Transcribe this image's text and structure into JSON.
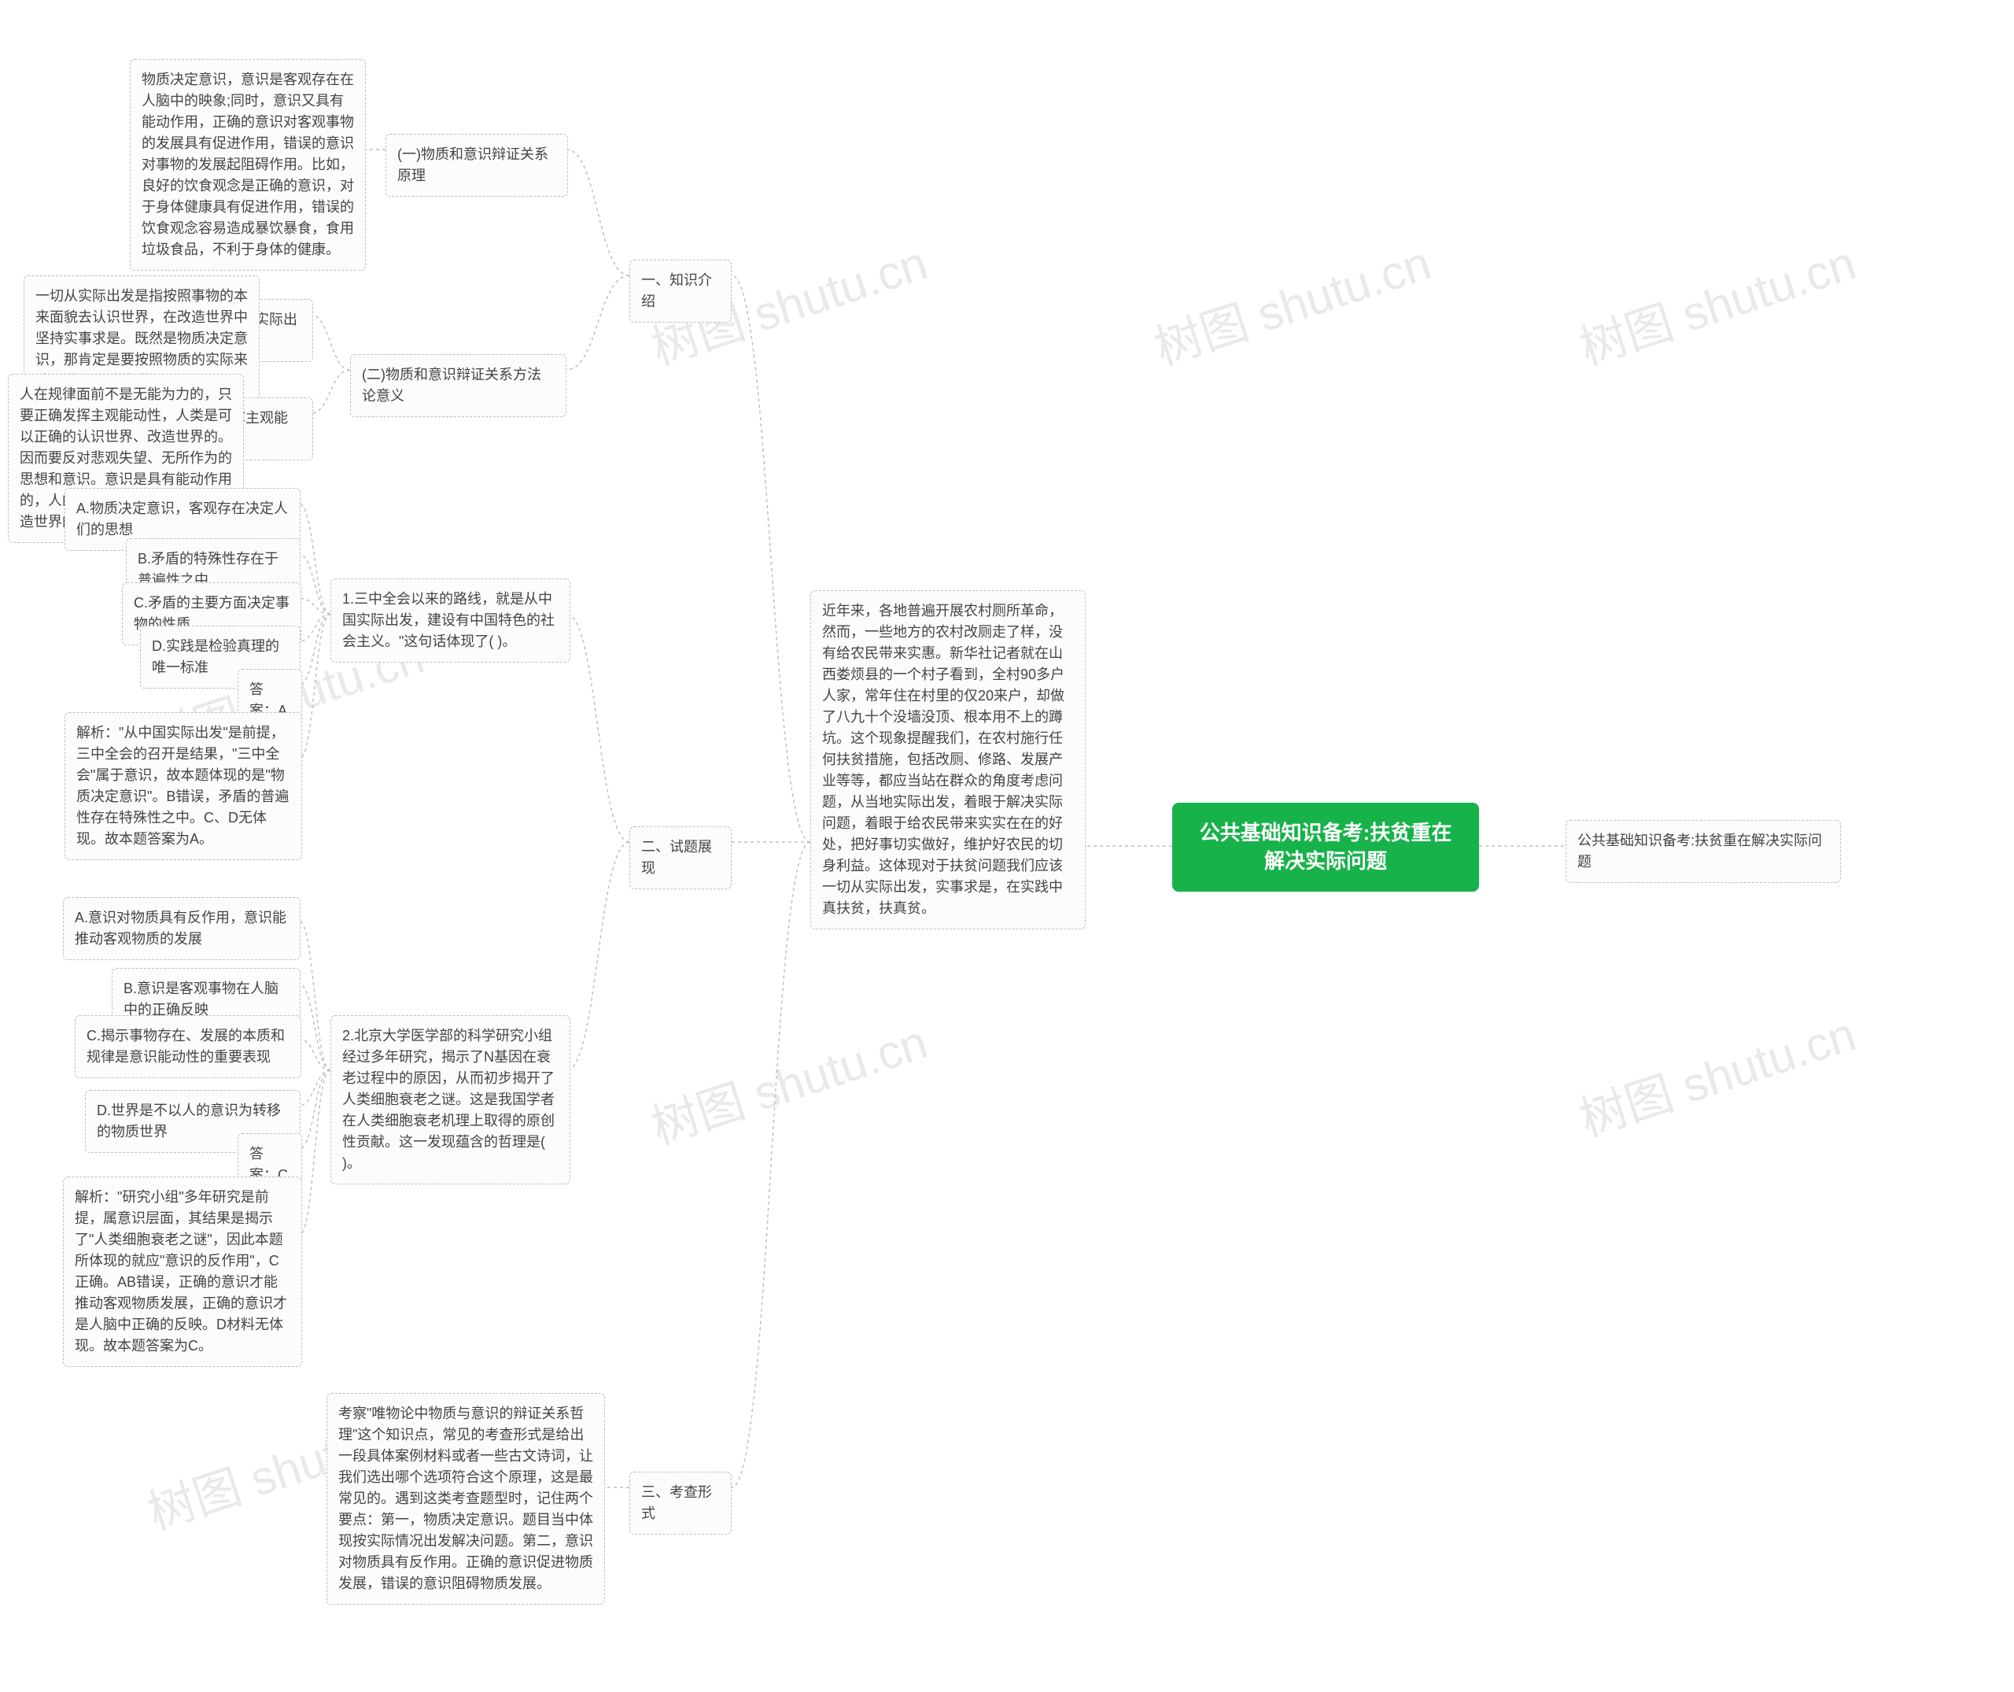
{
  "root": {
    "title": "公共基础知识备考:扶贫重在解决实际问题"
  },
  "right_leaf": {
    "text": "公共基础知识备考:扶贫重在解决实际问题"
  },
  "intro_paragraph": "近年来，各地普遍开展农村厕所革命，然而，一些地方的农村改厕走了样，没有给农民带来实惠。新华社记者就在山西娄烦县的一个村子看到，全村90多户人家，常年住在村里的仅20来户，却做了八九十个没墙没顶、根本用不上的蹲坑。这个现象提醒我们，在农村施行任何扶贫措施，包括改厕、修路、发展产业等等，都应当站在群众的角度考虑问题，从当地实际出发，着眼于解决实际问题，着眼于给农民带来实实在在的好处，把好事切实做好，维护好农民的切身利益。这体现对于扶贫问题我们应该一切从实际出发，实事求是，在实践中真扶贫，扶真贫。",
  "section1": {
    "label": "一、知识介绍",
    "sub1": {
      "label": "(一)物质和意识辩证关系原理",
      "desc": "物质决定意识，意识是客观存在在人脑中的映象;同时，意识又具有能动作用，正确的意识对客观事物的发展具有促进作用，错误的意识对事物的发展起阻碍作用。比如，良好的饮食观念是正确的意识，对于身体健康具有促进作用，错误的饮食观念容易造成暴饮暴食，食用垃圾食品，不利于身体的健康。"
    },
    "sub2": {
      "label": "(二)物质和意识辩证关系方法论意义",
      "sub2_1": {
        "label": "1.一切从实际出发",
        "desc": "一切从实际出发是指按照事物的本来面貌去认识世界，在改造世界中坚持实事求是。既然是物质决定意识，那肯定是要按照物质的实际来认识世界和改造世界。"
      },
      "sub2_2": {
        "label": "2.重视发挥主观能动性",
        "desc": "人在规律面前不是无能为力的，只要正确发挥主观能动性，人类是可以正确的认识世界、改造世界的。因而要反对悲观失望、无所作为的思想和意识。意识是具有能动作用的，人的意识是能够认识世界和改造世界的。"
      }
    }
  },
  "section2": {
    "label": "二、试题展现",
    "q1": {
      "stem": "1.三中全会以来的路线，就是从中国实际出发，建设有中国特色的社会主义。\"这句话体现了( )。",
      "a": "A.物质决定意识，客观存在决定人们的思想",
      "b": "B.矛盾的特殊性存在于普遍性之中",
      "c": "C.矛盾的主要方面决定事物的性质",
      "d": "D.实践是检验真理的唯一标准",
      "answer": "答案：A",
      "explain": "解析：\"从中国实际出发\"是前提，三中全会的召开是结果，\"三中全会\"属于意识，故本题体现的是\"物质决定意识\"。B错误，矛盾的普遍性存在特殊性之中。C、D无体现。故本题答案为A。"
    },
    "q2": {
      "stem": "2.北京大学医学部的科学研究小组经过多年研究，揭示了N基因在衰老过程中的原因，从而初步揭开了人类细胞衰老之谜。这是我国学者在人类细胞衰老机理上取得的原创性贡献。这一发现蕴含的哲理是( )。",
      "a": "A.意识对物质具有反作用，意识能推动客观物质的发展",
      "b": "B.意识是客观事物在人脑中的正确反映",
      "c": "C.揭示事物存在、发展的本质和规律是意识能动性的重要表现",
      "d": "D.世界是不以人的意识为转移的物质世界",
      "answer": "答案：C",
      "explain": "解析：\"研究小组\"多年研究是前提，属意识层面，其结果是揭示了\"人类细胞衰老之谜\"，因此本题所体现的就应\"意识的反作用\"，C正确。AB错误，正确的意识才能推动客观物质发展，正确的意识才是人脑中正确的反映。D材料无体现。故本题答案为C。"
    }
  },
  "section3": {
    "label": "三、考查形式",
    "desc": "考察\"唯物论中物质与意识的辩证关系哲理\"这个知识点，常见的考查形式是给出一段具体案例材料或者一些古文诗词，让我们选出哪个选项符合这个原理，这是最常见的。遇到这类考查题型时，记住两个要点：第一，物质决定意识。题目当中体现按实际情况出发解决问题。第二，意识对物质具有反作用。正确的意识促进物质发展，错误的意识阻碍物质发展。"
  },
  "watermark": "树图 shutu.cn"
}
